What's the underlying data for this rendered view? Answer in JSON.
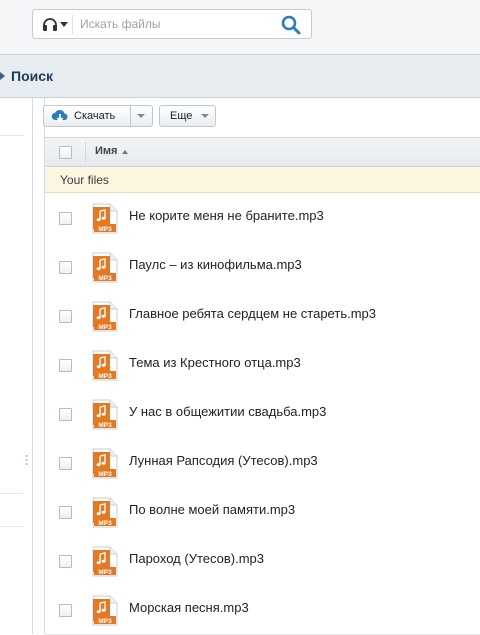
{
  "search": {
    "placeholder": "Искать файлы"
  },
  "header": {
    "title": "Поиск"
  },
  "toolbar": {
    "download_label": "Скачать",
    "more_label": "Еще"
  },
  "table": {
    "column_name": "Имя",
    "group_label": "Your files",
    "file_icon_text": "MP3",
    "rows": [
      {
        "name": "Не корите меня не браните.mp3"
      },
      {
        "name": "Паулс – из кинофильма.mp3"
      },
      {
        "name": "Главное ребята сердцем не стареть.mp3"
      },
      {
        "name": "Тема из Крестного отца.mp3"
      },
      {
        "name": "У нас в общежитии свадьба.mp3"
      },
      {
        "name": "Лунная Рапсодия (Утесов).mp3"
      },
      {
        "name": "По волне моей памяти.mp3"
      },
      {
        "name": "Пароход (Утесов).mp3"
      },
      {
        "name": "Морская песня.mp3"
      }
    ]
  },
  "colors": {
    "accent": "#2b7bc0",
    "file_icon": "#e8781e",
    "group_bg": "#fdf7e2"
  },
  "icons": [
    "headphones-icon",
    "search-icon",
    "cloud-download-icon",
    "mp3-file-icon",
    "chevron-down-icon"
  ]
}
